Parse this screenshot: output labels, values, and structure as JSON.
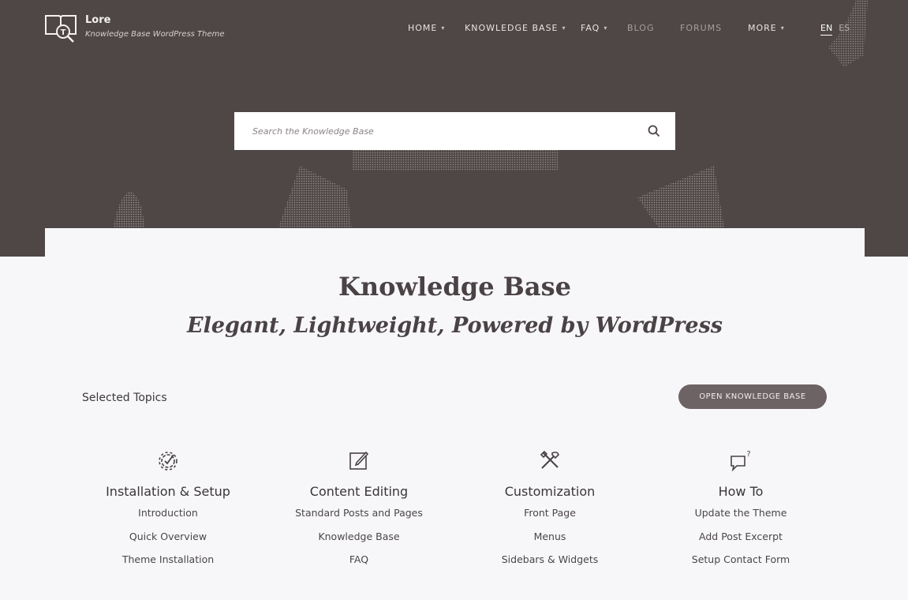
{
  "brand": {
    "name": "Lore",
    "tagline": "Knowledge Base WordPress Theme"
  },
  "nav": {
    "items": [
      {
        "label": "HOME",
        "has_dropdown": true
      },
      {
        "label": "KNOWLEDGE BASE",
        "has_dropdown": true
      },
      {
        "label": "FAQ",
        "has_dropdown": true
      },
      {
        "label": "BLOG",
        "has_dropdown": false
      },
      {
        "label": "FORUMS",
        "has_dropdown": false
      },
      {
        "label": "MORE",
        "has_dropdown": true
      }
    ],
    "languages": [
      "EN",
      "ES"
    ],
    "active_language": "EN"
  },
  "search": {
    "placeholder": "Search the Knowledge Base",
    "icon": "search-icon"
  },
  "main": {
    "title": "Knowledge Base",
    "subtitle": "Elegant, Lightweight, Powered by WordPress",
    "section_label": "Selected Topics",
    "open_kb_label": "OPEN KNOWLEDGE BASE"
  },
  "topics": [
    {
      "icon": "gear-check-icon",
      "heading": "Installation & Setup",
      "links": [
        "Introduction",
        "Quick Overview",
        "Theme Installation"
      ]
    },
    {
      "icon": "edit-icon",
      "heading": "Content Editing",
      "links": [
        "Standard Posts and Pages",
        "Knowledge Base",
        "FAQ"
      ]
    },
    {
      "icon": "tools-icon",
      "heading": "Customization",
      "links": [
        "Front Page",
        "Menus",
        "Sidebars & Widgets"
      ]
    },
    {
      "icon": "chat-question-icon",
      "heading": "How To",
      "links": [
        "Update the Theme",
        "Add Post Excerpt",
        "Setup Contact Form"
      ]
    }
  ],
  "colors": {
    "hero_bg": "#4f4646",
    "page_bg": "#f7f7fa",
    "button_bg": "#6d6264",
    "text_dark": "#4a4244"
  }
}
